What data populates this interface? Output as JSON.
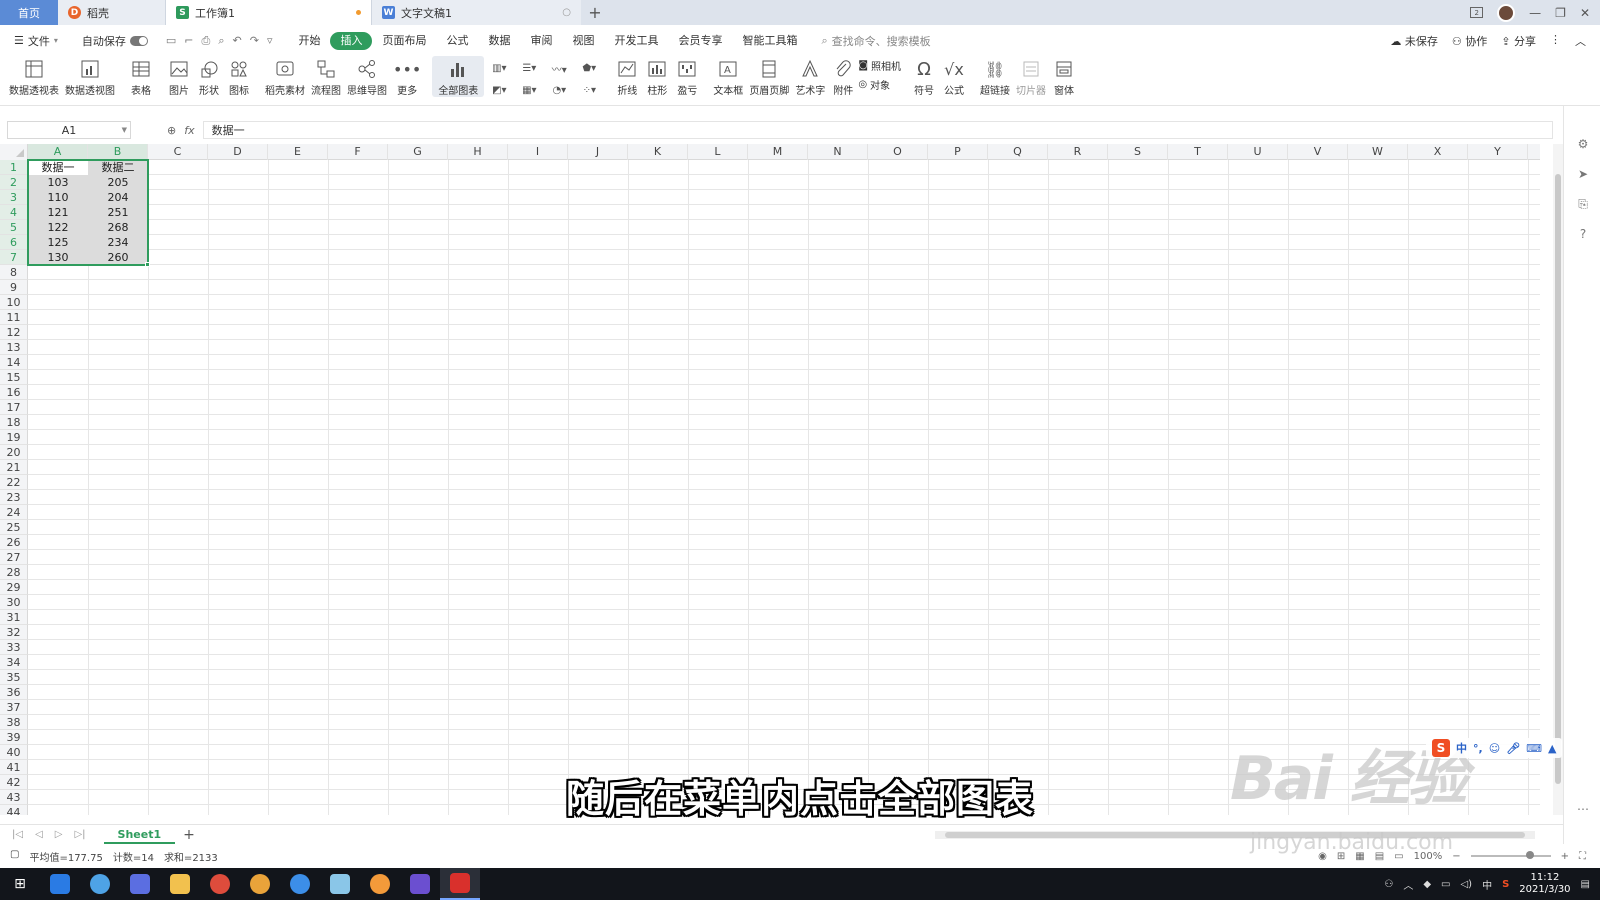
{
  "titlebar": {
    "home_tab": "首页",
    "tabs": [
      {
        "label": "稻壳",
        "icon": "D"
      },
      {
        "label": "工作簿1",
        "icon": "S",
        "active": true,
        "modified": true
      },
      {
        "label": "文字文稿1",
        "icon": "W"
      }
    ],
    "new_tab": "+"
  },
  "menubar": {
    "file": "文件",
    "autosave": "自动保存",
    "tabs": [
      "开始",
      "插入",
      "页面布局",
      "公式",
      "数据",
      "审阅",
      "视图",
      "开发工具",
      "会员专享",
      "智能工具箱"
    ],
    "selected_tab": "插入",
    "search_placeholder": "查找命令、搜索模板",
    "right": [
      "未保存",
      "协作",
      "分享"
    ]
  },
  "ribbon": {
    "buttons": [
      "数据透视表",
      "数据透视图",
      "表格",
      "图片",
      "形状",
      "图标",
      "稻壳素材",
      "流程图",
      "思维导图",
      "更多",
      "全部图表",
      "折线",
      "柱形",
      "盈亏",
      "文本框",
      "页眉页脚",
      "艺术字",
      "附件",
      "照相机",
      "对象",
      "符号",
      "公式",
      "超链接",
      "切片器",
      "窗体"
    ]
  },
  "formulabar": {
    "cell_ref": "A1",
    "fx": "fx",
    "value": "数据一"
  },
  "grid": {
    "columns": [
      "A",
      "B",
      "C",
      "D",
      "E",
      "F",
      "G",
      "H",
      "I",
      "J",
      "K",
      "L",
      "M",
      "N",
      "O",
      "P",
      "Q",
      "R",
      "S",
      "T",
      "U",
      "V",
      "W",
      "X",
      "Y"
    ],
    "row_count": 44,
    "header": [
      "数据一",
      "数据二"
    ],
    "rows": [
      [
        "103",
        "205"
      ],
      [
        "110",
        "204"
      ],
      [
        "121",
        "251"
      ],
      [
        "122",
        "268"
      ],
      [
        "125",
        "234"
      ],
      [
        "130",
        "260"
      ]
    ]
  },
  "sheets": {
    "active": "Sheet1",
    "add": "+"
  },
  "status": {
    "avg": "平均值=177.75",
    "count": "计数=14",
    "sum": "求和=2133",
    "zoom": "100%"
  },
  "taskbar": {
    "time": "11:12",
    "date": "2021/3/30",
    "ime_lang": "中"
  },
  "overlay": {
    "subtitle": "随后在菜单内点击全部图表",
    "watermark": "Bai 经验",
    "watermark_url": "jingyan.baidu.com"
  }
}
